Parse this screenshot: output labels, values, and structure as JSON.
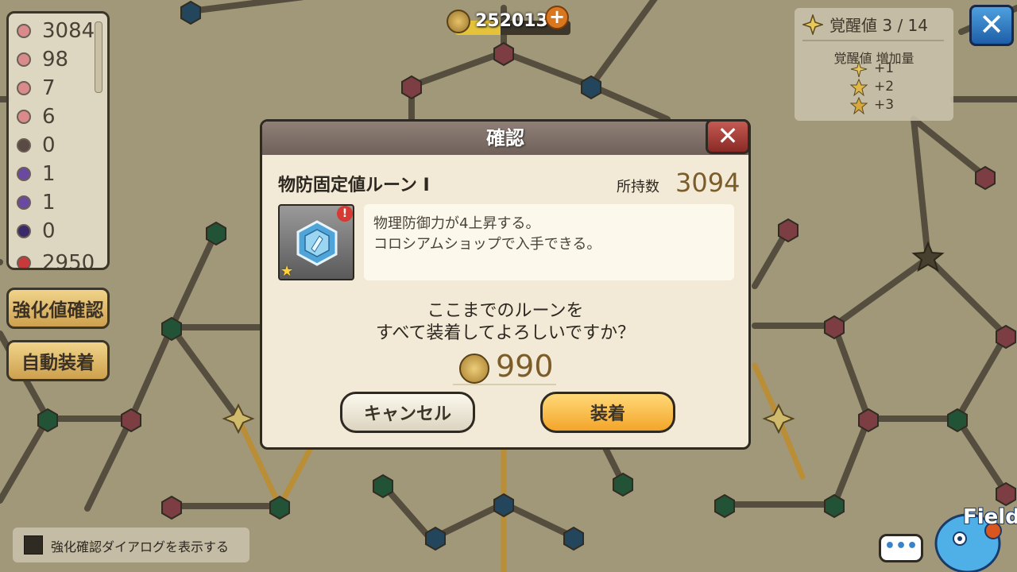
{
  "header": {
    "coins": "2520131",
    "coin_fill_fraction": 0.4,
    "plus_label": "+",
    "close_glyph": "✕"
  },
  "awaken": {
    "title": "覚醒値 3 / 14",
    "subtitle": "覚醒値 増加量",
    "rows": [
      "+1",
      "+2",
      "+3"
    ]
  },
  "rune_list": {
    "counts": [
      "3084",
      "98",
      "7",
      "6",
      "0",
      "1",
      "1",
      "0",
      "2950"
    ],
    "gem_colors": [
      "#d98a8a",
      "#d98a8a",
      "#d98a8a",
      "#d98a8a",
      "#5a4a44",
      "#6a4aa0",
      "#6a4aa0",
      "#3a2a6a",
      "#c83a3a"
    ]
  },
  "side_buttons": {
    "enhance_check": "強化値確認",
    "auto_equip": "自動装着"
  },
  "dialog": {
    "title": "確認",
    "close_glyph": "✕",
    "item_name": "物防固定値ルーン I",
    "own_label": "所持数",
    "own_value": "3094",
    "desc_lines": [
      "物理防御力が4上昇する。",
      "コロシアムショップで入手できる。"
    ],
    "question_lines": [
      "ここまでのルーンを",
      "すべて装着してよろしいですか？"
    ],
    "cost": "990",
    "cancel_label": "キャンセル",
    "equip_label": "装着",
    "alert_glyph": "!",
    "star_glyph": "★"
  },
  "footer": {
    "checkbox_label": "強化確認ダイアログを表示する",
    "chat_glyph": "•••",
    "field_label": "Field"
  },
  "colors": {
    "panel_brown": "#6f615a",
    "accent_gold": "#7c5c28",
    "equip_orange": "#f3a52a",
    "node_red": "#8a4048",
    "node_blue": "#1e4a6a",
    "node_green": "#1e5a3a",
    "path_gold": "#d6a23a",
    "path_dark": "#5a5040"
  }
}
